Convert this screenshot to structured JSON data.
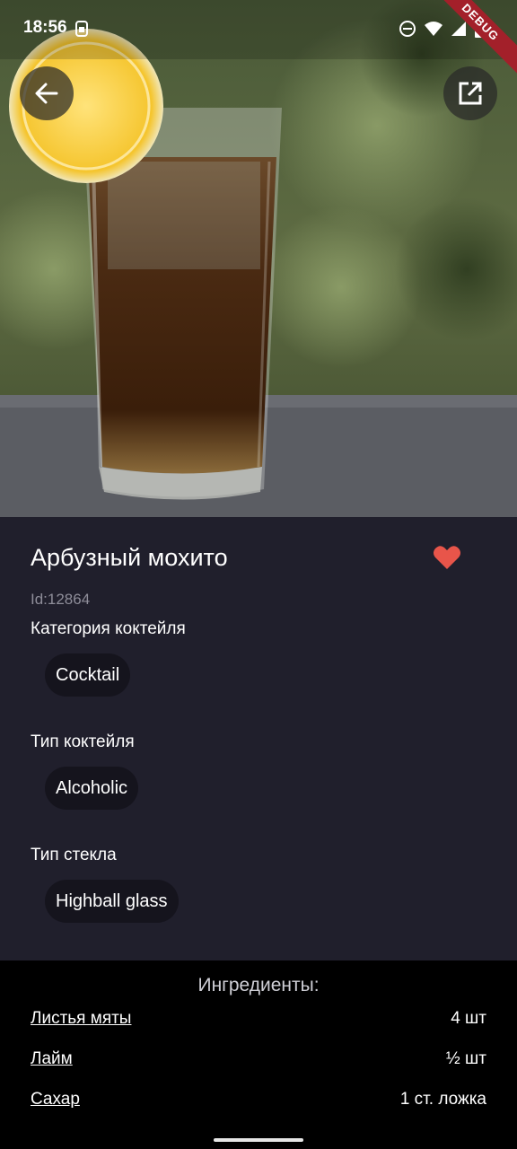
{
  "status_bar": {
    "time": "18:56",
    "debug_label": "DEBUG",
    "icons": [
      "sim-icon",
      "dnd-icon",
      "wifi-icon",
      "signal-icon",
      "battery-icon"
    ]
  },
  "header": {
    "back_icon": "arrow-left-icon",
    "share_icon": "open-external-icon"
  },
  "drink": {
    "name": "Арбузный мохито",
    "id_text": "Id:12864",
    "favorite": true,
    "favorite_color": "#e8554a",
    "category_label": "Категория коктейля",
    "category_value": "Cocktail",
    "type_label": "Тип коктейля",
    "type_value": "Alcoholic",
    "glass_label": "Тип стекла",
    "glass_value": "Highball glass"
  },
  "ingredients": {
    "title": "Ингредиенты:",
    "items": [
      {
        "name": "Листья мяты",
        "qty": "4 шт"
      },
      {
        "name": "Лайм",
        "qty": "½ шт"
      },
      {
        "name": "Сахар",
        "qty": "1 ст. ложка"
      }
    ]
  }
}
